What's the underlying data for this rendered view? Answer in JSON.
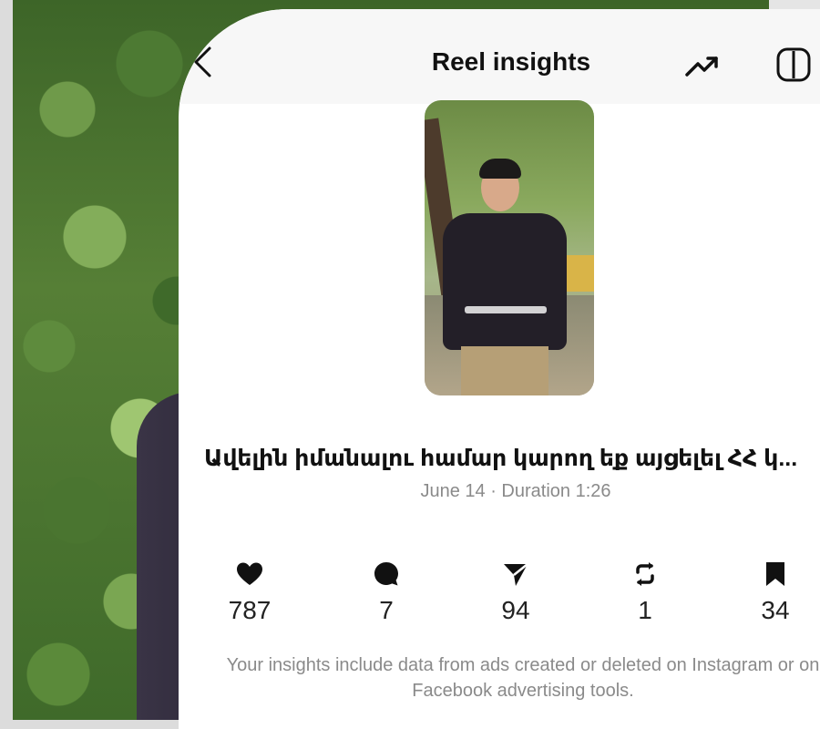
{
  "header": {
    "title": "Reel insights",
    "back_icon": "chevron-left-icon",
    "trend_icon": "trending-up-icon",
    "compare_icon": "compare-icon"
  },
  "reel": {
    "caption": "Ավելին իմանալու համար կարող եք այցելել ՀՀ կ...",
    "meta": "June 14 · Duration 1:26"
  },
  "stats": [
    {
      "icon": "heart-icon",
      "value": "787"
    },
    {
      "icon": "comment-icon",
      "value": "7"
    },
    {
      "icon": "share-icon",
      "value": "94"
    },
    {
      "icon": "repost-icon",
      "value": "1"
    },
    {
      "icon": "bookmark-icon",
      "value": "34"
    }
  ],
  "note": "Your insights include data from ads created or deleted on Instagram or on Facebook advertising tools.",
  "colors": {
    "text": "#111111",
    "muted": "#8a8a8a",
    "header_bg": "#f7f7f7"
  }
}
